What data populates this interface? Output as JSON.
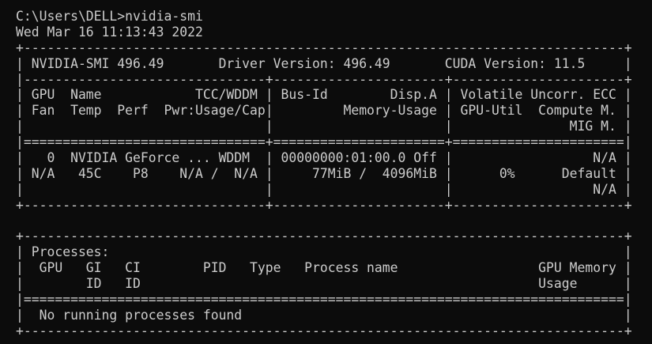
{
  "terminal": {
    "lines": [
      "C:\\Users\\DELL>nvidia-smi",
      "Wed Mar 16 11:13:43 2022",
      "+-----------------------------------------------------------------------------+",
      "| NVIDIA-SMI 496.49       Driver Version: 496.49       CUDA Version: 11.5     |",
      "|-------------------------------+----------------------+----------------------+",
      "| GPU  Name            TCC/WDDM | Bus-Id        Disp.A | Volatile Uncorr. ECC |",
      "| Fan  Temp  Perf  Pwr:Usage/Cap|         Memory-Usage | GPU-Util  Compute M. |",
      "|                               |                      |               MIG M. |",
      "|===============================+======================+======================|",
      "|   0  NVIDIA GeForce ... WDDM  | 00000000:01:00.0 Off |                  N/A |",
      "| N/A   45C    P8    N/A /  N/A |     77MiB /  4096MiB |      0%      Default |",
      "|                               |                      |                  N/A |",
      "+-------------------------------+----------------------+----------------------+",
      "",
      "+-----------------------------------------------------------------------------+",
      "| Processes:                                                                  |",
      "|  GPU   GI   CI        PID   Type   Process name                  GPU Memory |",
      "|        ID   ID                                                   Usage      |",
      "|=============================================================================|",
      "|  No running processes found                                                 |",
      "+-----------------------------------------------------------------------------+"
    ]
  }
}
